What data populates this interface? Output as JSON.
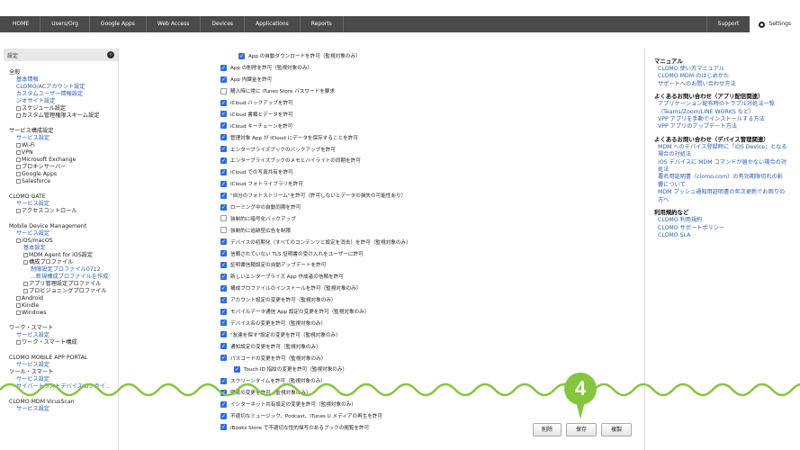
{
  "topnav": {
    "tabs": [
      "HOME",
      "Users/Org",
      "Google Apps",
      "Web Access",
      "Devices",
      "Applications",
      "Reports"
    ],
    "support": "Support",
    "settings": "Settings"
  },
  "sidebar": {
    "header": "設定",
    "sections": [
      {
        "title": "全般",
        "items": [
          {
            "text": "基本情報",
            "type": "link",
            "level": 1
          },
          {
            "text": "CLOMO/ACアカウント設定",
            "type": "link",
            "level": 1
          },
          {
            "text": "カスタムユーザー情報設定",
            "type": "link",
            "level": 1
          },
          {
            "text": "ジオサイト設定",
            "type": "link",
            "level": 1
          },
          {
            "text": "スケジュール設定",
            "type": "node",
            "level": 1
          },
          {
            "text": "カスタム管理権限スキーム設定",
            "type": "node",
            "level": 1
          }
        ]
      },
      {
        "title": "サービス構成設定",
        "items": [
          {
            "text": "サービス設定",
            "type": "link",
            "level": 1
          },
          {
            "text": "Wi-Fi",
            "type": "node",
            "level": 1
          },
          {
            "text": "VPN",
            "type": "node",
            "level": 1
          },
          {
            "text": "Microsoft Exchange",
            "type": "node",
            "level": 1
          },
          {
            "text": "プロキシサーバー",
            "type": "node",
            "level": 1
          },
          {
            "text": "Google Apps",
            "type": "node",
            "level": 1
          },
          {
            "text": "Salesforce",
            "type": "node",
            "level": 1
          }
        ]
      },
      {
        "title": "CLOMO GATE",
        "items": [
          {
            "text": "サービス設定",
            "type": "link",
            "level": 1
          },
          {
            "text": "アクセスコントロール",
            "type": "node",
            "level": 1
          }
        ]
      },
      {
        "title": "Mobile Device Management",
        "items": [
          {
            "text": "サービス設定",
            "type": "link",
            "level": 1
          },
          {
            "text": "iOS/macOS",
            "type": "node",
            "level": 1
          },
          {
            "text": "基本設定",
            "type": "link",
            "level": 2
          },
          {
            "text": "MDM Agent for iOS設定",
            "type": "node",
            "level": 2
          },
          {
            "text": "構成プロファイル",
            "type": "node",
            "level": 2
          },
          {
            "text": "制限設定プロファイル0712",
            "type": "link",
            "level": 3
          },
          {
            "text": "...新規構成プロファイルを作成",
            "type": "link",
            "level": 3
          },
          {
            "text": "アプリ管理設定プロファイル",
            "type": "node",
            "level": 2
          },
          {
            "text": "プロビジョニングプロファイル",
            "type": "node",
            "level": 2
          },
          {
            "text": "Android",
            "type": "node",
            "level": 1
          },
          {
            "text": "Kindle",
            "type": "node",
            "level": 1
          },
          {
            "text": "Windows",
            "type": "node",
            "level": 1
          }
        ]
      },
      {
        "title": "ワーク・スマート",
        "items": [
          {
            "text": "サービス設定",
            "type": "link",
            "level": 1
          },
          {
            "text": "ワーク・スマート構成",
            "type": "node",
            "level": 1
          }
        ]
      },
      {
        "title": "CLOMO MOBILE APP PORTAL",
        "items": [
          {
            "text": "サービス設定",
            "type": "link",
            "level": 1
          },
          {
            "text": "ツール・スマート",
            "type": "plain",
            "level": 0
          },
          {
            "text": "サービス設定",
            "type": "link",
            "level": 1
          },
          {
            "text": "サイバートラストデバイスIDクライ...",
            "type": "link",
            "level": 1
          }
        ]
      },
      {
        "title": "CLOMO MDM VirusScan",
        "items": [
          {
            "text": "サービス設定",
            "type": "link",
            "level": 1
          }
        ]
      }
    ]
  },
  "options": [
    {
      "label": "App の自動ダウンロードを許可（監視対象のみ）",
      "checked": true,
      "indent": "indent"
    },
    {
      "label": "App の削除を許可（監視対象のみ）",
      "checked": true,
      "indent": ""
    },
    {
      "label": "App 内課金を許可",
      "checked": true,
      "indent": ""
    },
    {
      "label": "購入時に常に iTunes Store パスワードを要求",
      "checked": false,
      "indent": ""
    },
    {
      "label": "iCloud バックアップを許可",
      "checked": true,
      "indent": ""
    },
    {
      "label": "iCloud 書類とデータを許可",
      "checked": true,
      "indent": ""
    },
    {
      "label": "iCloud キーチェーンを許可",
      "checked": true,
      "indent": ""
    },
    {
      "label": "管理対象 App が iCloud にデータを保存することを許可",
      "checked": true,
      "indent": ""
    },
    {
      "label": "エンタープライズブックのバックアップを許可",
      "checked": true,
      "indent": ""
    },
    {
      "label": "エンタープライズブックのメモとハイライトの同期を許可",
      "checked": true,
      "indent": ""
    },
    {
      "label": "iCloud での写真共有を許可",
      "checked": true,
      "indent": ""
    },
    {
      "label": "iCloud フォトライブラリを許可",
      "checked": true,
      "indent": ""
    },
    {
      "label": "\"自分のフォトストリーム\"を許可（許可しないとデータの損失の可能性あり）",
      "checked": true,
      "indent": ""
    },
    {
      "label": "ローミング中の自動同期を許可",
      "checked": true,
      "indent": ""
    },
    {
      "label": "強制的に暗号化バックアップ",
      "checked": false,
      "indent": ""
    },
    {
      "label": "強制的に追跡型広告を制限",
      "checked": false,
      "indent": ""
    },
    {
      "label": "デバイスの初期化（すべてのコンテンツと設定を消去）を許可（監視対象のみ）",
      "checked": true,
      "indent": ""
    },
    {
      "label": "信頼されていない TLS 証明書の受け入れをユーザーに許可",
      "checked": true,
      "indent": ""
    },
    {
      "label": "証明書信頼設定の自動アップデートを許可",
      "checked": true,
      "indent": ""
    },
    {
      "label": "新しいエンタープライズ App 作成者の信頼を許可",
      "checked": true,
      "indent": ""
    },
    {
      "label": "構成プロファイルのインストールを許可（監視対象のみ）",
      "checked": true,
      "indent": ""
    },
    {
      "label": "アカウント設定の変更を許可（監視対象のみ）",
      "checked": true,
      "indent": ""
    },
    {
      "label": "モバイルデータ通信 App 設定の変更を許可（監視対象のみ）",
      "checked": true,
      "indent": ""
    },
    {
      "label": "デバイス名の変更を許可（監視対象のみ）",
      "checked": true,
      "indent": ""
    },
    {
      "label": "\"友達を探す\"設定の変更を許可（監視対象のみ）",
      "checked": true,
      "indent": ""
    },
    {
      "label": "通知設定の変更を許可（監視対象のみ）",
      "checked": true,
      "indent": ""
    },
    {
      "label": "パスコードの変更を許可（監視対象のみ）",
      "checked": true,
      "indent": ""
    },
    {
      "label": "Touch ID 指紋の変更を許可（監視対象のみ）",
      "checked": true,
      "indent": "indent2"
    },
    {
      "label": "スクリーンタイムを許可（監視対象のみ）",
      "checked": true,
      "indent": ""
    },
    {
      "label": "壁紙の変更を許可（監視対象のみ）",
      "checked": true,
      "indent": ""
    },
    {
      "label": "インターネット共有設定の変更を許可（監視対象のみ）",
      "checked": true,
      "indent": ""
    },
    {
      "label": "不適切なミュージック、Podcast、iTunes U メディアの再生を許可",
      "checked": true,
      "indent": ""
    },
    {
      "label": "iBooks Store で不適切な性的描写のあるブックの閲覧を許可",
      "checked": true,
      "indent": ""
    }
  ],
  "rightpanel": [
    {
      "title": "マニュアル",
      "links": [
        "CLOMO 使い方マニュアル",
        "CLOMO MDM のはじめかた",
        "サポートへのお問い合わせ方法"
      ]
    },
    {
      "title": "よくあるお問い合わせ（アプリ配信関連）",
      "links": [
        "アプリケーション配布時のトラブル対処法一覧",
        "（Teams/Zoom/LINE WORKS など）",
        "VPP アプリを手動でインストールする方法",
        "VPP アプリのアップデート方法"
      ]
    },
    {
      "title": "よくあるお問い合わせ（デバイス管理関連）",
      "links": [
        "MDM へのデバイス登録時に「iOS Device」となる",
        "場合の対処法",
        "iOS デバイスに MDM コマンドが届かない場合の対",
        "処法",
        "署名用証明書（clomo.com）の有効期限切れの影",
        "響について",
        "MDM プッシュ通知用証明書の年次更新でお困りの",
        "方へ"
      ]
    },
    {
      "title": "利用規約など",
      "links": [
        "CLOMO 利用規約",
        "CLOMO サポートポリシー",
        "CLOMO SLA"
      ]
    }
  ],
  "buttons": {
    "delete": "削除",
    "save": "保存",
    "duplicate": "複製"
  },
  "badge": "4",
  "colors": {
    "nav": "#4a4a4a",
    "accent": "#86c540",
    "link": "#2a5db0",
    "checkbox": "#2f6fd6"
  }
}
